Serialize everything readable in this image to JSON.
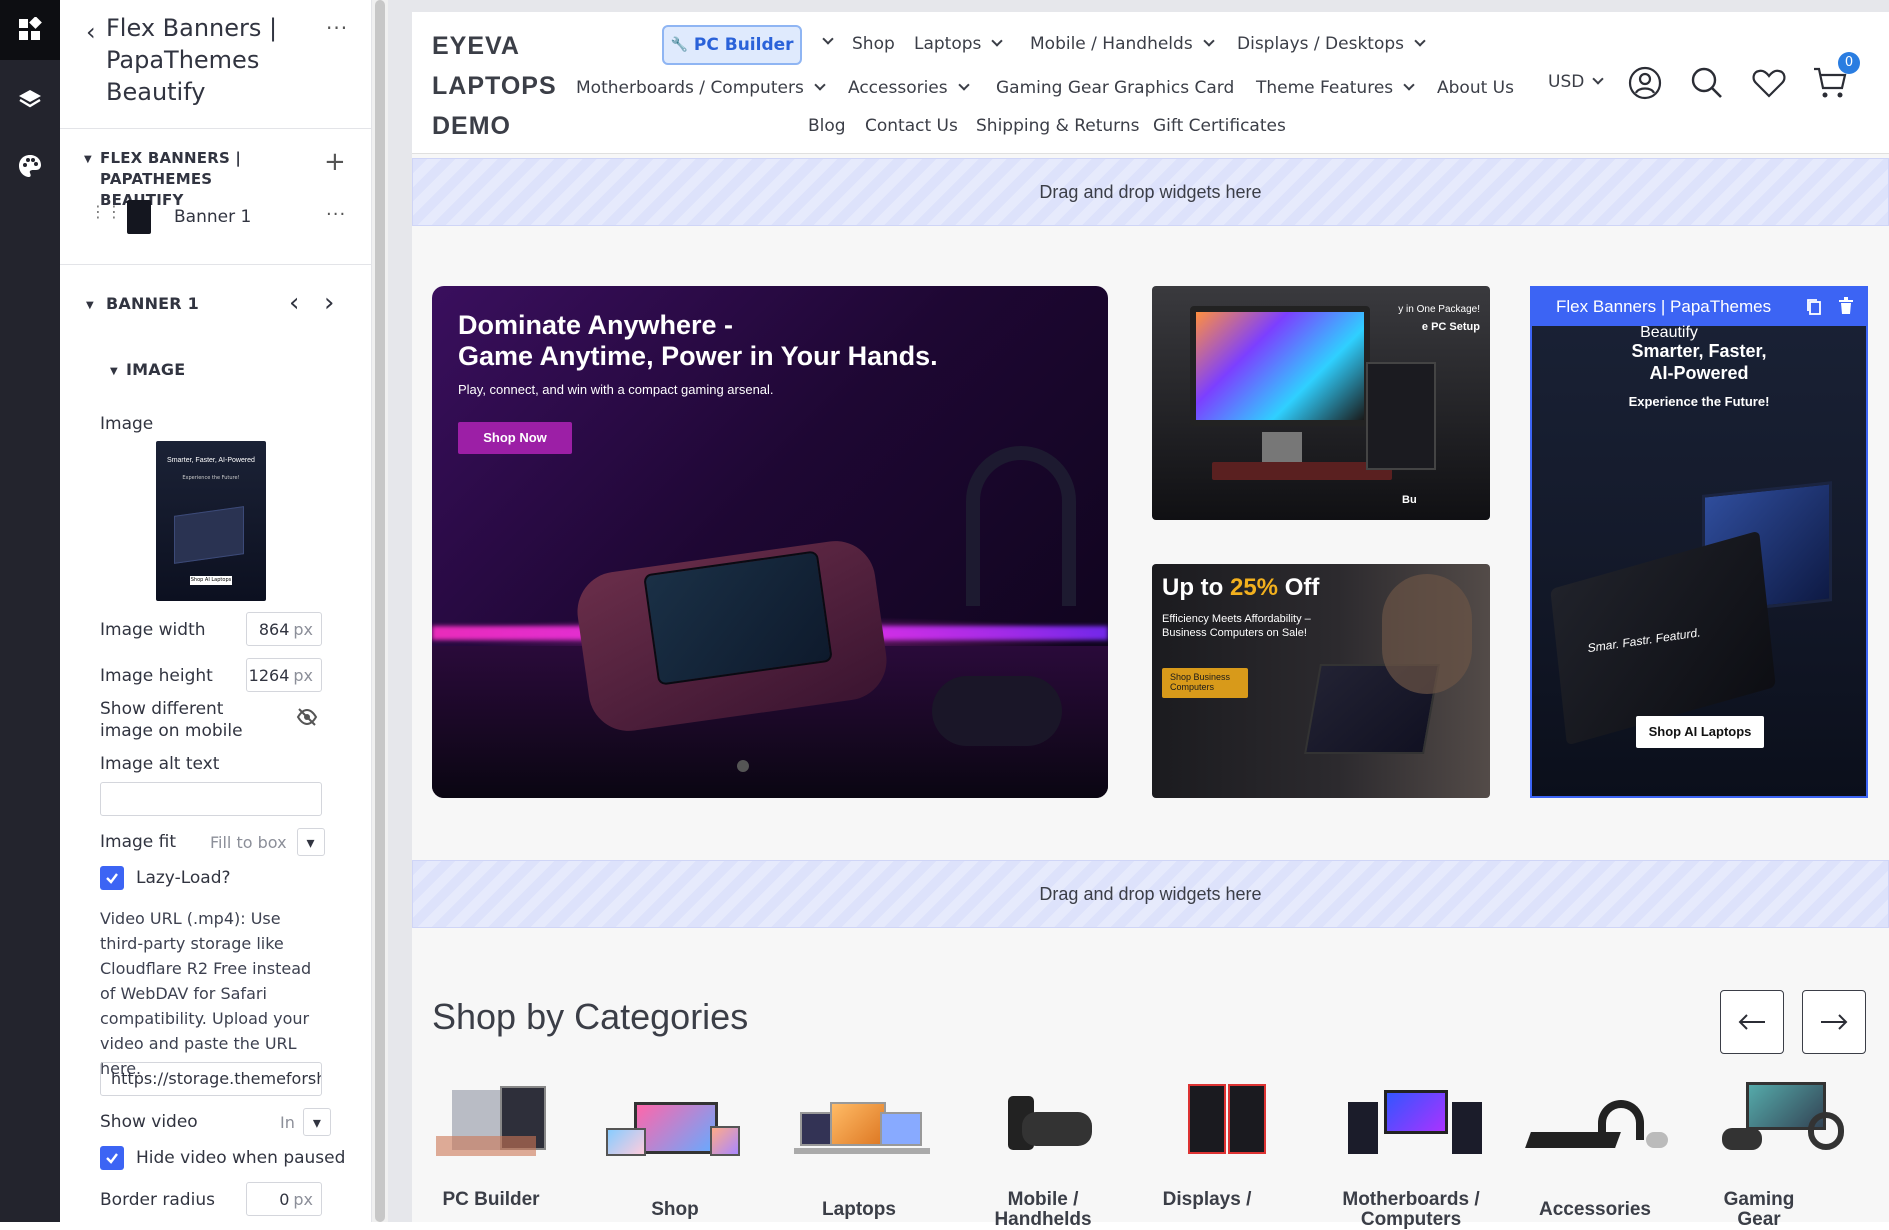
{
  "editor": {
    "back_title": "Flex Banners | PapaThemes Beautify",
    "widget_section": "FLEX BANNERS | PAPATHEMES BEAUTIFY",
    "item_label": "Banner 1",
    "banner_section": "BANNER 1",
    "image_section": "IMAGE",
    "image_label": "Image",
    "thumb_headline": "Smarter, Faster, AI-Powered",
    "thumb_sub": "Experience the Future!",
    "thumb_btn": "Shop AI Laptops",
    "image_width_label": "Image width",
    "image_width": "864",
    "image_height_label": "Image height",
    "image_height": "1264",
    "unit": "px",
    "mobile_label": "Show different image on mobile",
    "alt_label": "Image alt text",
    "alt_value": "",
    "fit_label": "Image fit",
    "fit_value": "Fill to box",
    "lazy_label": "Lazy-Load?",
    "video_help": "Video URL (.mp4): Use third-party storage like Cloudflare R2 Free instead of WebDAV for Safari compatibility. Upload your video and paste the URL here.",
    "video_url": "https://storage.themeforsh",
    "show_video_label": "Show video",
    "show_video_value": "In",
    "hide_video_label": "Hide video when paused",
    "border_radius_label": "Border radius",
    "border_radius": "0"
  },
  "header": {
    "logo": [
      "EYEVA",
      "LAPTOPS",
      "DEMO"
    ],
    "pc_builder": "PC Builder",
    "nav_row1": [
      "Shop",
      "Laptops",
      "Mobile / Handhelds",
      "Displays / Desktops"
    ],
    "nav_row2": [
      "Motherboards / Computers",
      "Accessories",
      "Gaming Gear",
      "Graphics Card",
      "Theme Features",
      "About Us"
    ],
    "nav_row3": [
      "Blog",
      "Contact Us",
      "Shipping & Returns",
      "Gift Certificates"
    ],
    "currency": "USD",
    "cart_count": "0"
  },
  "drop_text": "Drag and drop widgets here",
  "banners": {
    "main_title_1": "Dominate Anywhere -",
    "main_title_2": "Game Anytime, Power in Your Hands.",
    "main_sub": "Play, connect, and win with a compact gaming arsenal.",
    "main_btn": "Shop Now",
    "pc_text_1": "y in One Package!",
    "pc_text_2": "e PC Setup",
    "pc_text_3": "Bu",
    "off_prefix": "Up to ",
    "off_pct": "25%",
    "off_suffix": " Off",
    "off_sub": "Efficiency Meets Affordability – Business Computers on Sale!",
    "off_btn": "Shop Business Computers",
    "sel_toolbar": "Flex Banners | PapaThemes",
    "ai_beautify": "Beautify",
    "ai_title_1": "Smarter, Faster,",
    "ai_title_2": "AI-Powered",
    "ai_sub": "Experience the Future!",
    "ai_laptop_text": "Smar. Fastr. Featurd.",
    "ai_btn": "Shop AI Laptops"
  },
  "categories": {
    "title": "Shop by Categories",
    "items": [
      {
        "label": "PC Builder"
      },
      {
        "label": "Shop"
      },
      {
        "label": "Laptops"
      },
      {
        "label": "Mobile / Handhelds"
      },
      {
        "label": "Displays /"
      },
      {
        "label": "Motherboards / Computers"
      },
      {
        "label": "Accessories"
      },
      {
        "label": "Gaming Gear"
      }
    ]
  },
  "colors": {
    "accent": "#3c64f4",
    "brand_purple": "#9c1fa6",
    "gold": "#f2b01e",
    "editor_rail": "#23242d"
  },
  "icons": [
    "widgets-icon",
    "layers-icon",
    "palette-icon",
    "user-icon",
    "search-icon",
    "heart-icon",
    "cart-icon"
  ]
}
